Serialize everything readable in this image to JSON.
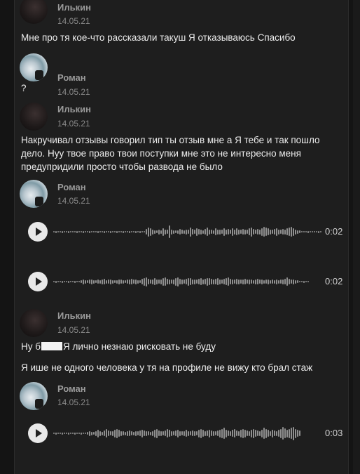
{
  "messages": [
    {
      "author": "Илькин",
      "date": "14.05.21",
      "avatar": "avatar-dark",
      "lines": [
        "Мне про тя кое-что рассказали такуш Я отказываюсь Спасибо"
      ]
    },
    {
      "author": "Роман",
      "date": "14.05.21",
      "avatar": "avatar-photo",
      "lines": [
        "?"
      ]
    },
    {
      "author": "Илькин",
      "date": "14.05.21",
      "avatar": "avatar-dark",
      "lines": [
        "Накручивал отзывы говорил тип ты отзыв мне а Я тебе и так пошло",
        "дело. Нуу твое право твои поступки мне это не интересно меня",
        "предупридили просто чтобы развода не было"
      ]
    },
    {
      "author": "Роман",
      "date": "14.05.21",
      "avatar": "avatar-photo",
      "voice": [
        {
          "duration": "0:02"
        },
        {
          "duration": "0:02"
        }
      ]
    },
    {
      "author": "Илькин",
      "date": "14.05.21",
      "avatar": "avatar-dark",
      "line_prefix": "Ну б",
      "line_suffix": "Я лично незнаю рисковать не буду",
      "lines2": [
        "Я ише не одного человека у тя на профиле не вижу кто брал стаж"
      ]
    },
    {
      "author": "Роман",
      "date": "14.05.21",
      "avatar": "avatar-photo",
      "voice": [
        {
          "duration": "0:03"
        }
      ]
    }
  ],
  "icons": {
    "play": "play-icon"
  }
}
